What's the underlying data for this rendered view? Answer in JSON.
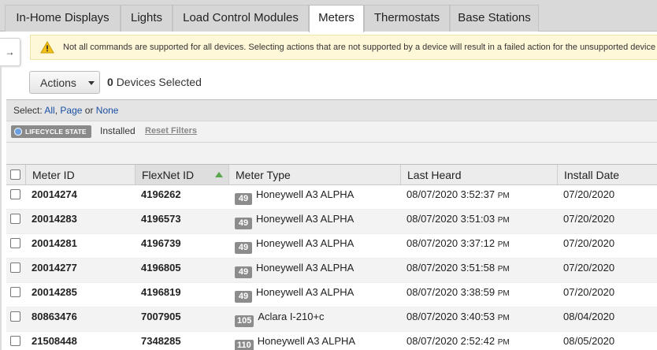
{
  "tabs": [
    {
      "label": "In-Home Displays",
      "active": false
    },
    {
      "label": "Lights",
      "active": false
    },
    {
      "label": "Load Control Modules",
      "active": false
    },
    {
      "label": "Meters",
      "active": true
    },
    {
      "label": "Thermostats",
      "active": false
    },
    {
      "label": "Base Stations",
      "active": false
    }
  ],
  "side_toggle": "→",
  "notice": {
    "icon": "warning-icon",
    "text": "Not all commands are supported for all devices. Selecting actions that are not supported by a device will result in a failed action for the unsupported device"
  },
  "toolbar": {
    "actions_label": "Actions",
    "selected_count": "0",
    "selected_suffix": "Devices Selected"
  },
  "select_bar": {
    "prefix": "Select:",
    "all": "All",
    "sep1": ",",
    "page": "Page",
    "or": "or",
    "none": "None"
  },
  "filters": {
    "chip_label": "LIFECYCLE STATE",
    "chip_value": "Installed",
    "reset_label": "Reset Filters"
  },
  "table": {
    "columns": [
      "Meter ID",
      "FlexNet ID",
      "Meter Type",
      "Last Heard",
      "Install Date"
    ],
    "sorted_column": "FlexNet ID",
    "sort_direction": "ascending",
    "rows": [
      {
        "meter_id": "20014274",
        "flexnet_id": "4196262",
        "type_code": "49",
        "type_name": "Honeywell A3 ALPHA",
        "last_heard": "08/07/2020 3:52:37",
        "ampm": "PM",
        "install_date": "07/20/2020"
      },
      {
        "meter_id": "20014283",
        "flexnet_id": "4196573",
        "type_code": "49",
        "type_name": "Honeywell A3 ALPHA",
        "last_heard": "08/07/2020 3:51:03",
        "ampm": "PM",
        "install_date": "07/20/2020"
      },
      {
        "meter_id": "20014281",
        "flexnet_id": "4196739",
        "type_code": "49",
        "type_name": "Honeywell A3 ALPHA",
        "last_heard": "08/07/2020 3:37:12",
        "ampm": "PM",
        "install_date": "07/20/2020"
      },
      {
        "meter_id": "20014277",
        "flexnet_id": "4196805",
        "type_code": "49",
        "type_name": "Honeywell A3 ALPHA",
        "last_heard": "08/07/2020 3:51:58",
        "ampm": "PM",
        "install_date": "07/20/2020"
      },
      {
        "meter_id": "20014285",
        "flexnet_id": "4196819",
        "type_code": "49",
        "type_name": "Honeywell A3 ALPHA",
        "last_heard": "08/07/2020 3:38:59",
        "ampm": "PM",
        "install_date": "07/20/2020"
      },
      {
        "meter_id": "80863476",
        "flexnet_id": "7007905",
        "type_code": "105",
        "type_name": "Aclara I-210+c",
        "last_heard": "08/07/2020 3:40:53",
        "ampm": "PM",
        "install_date": "08/04/2020"
      },
      {
        "meter_id": "21508448",
        "flexnet_id": "7348285",
        "type_code": "110",
        "type_name": "Honeywell A3 ALPHA",
        "last_heard": "08/07/2020 2:52:42",
        "ampm": "PM",
        "install_date": "08/05/2020"
      }
    ]
  }
}
